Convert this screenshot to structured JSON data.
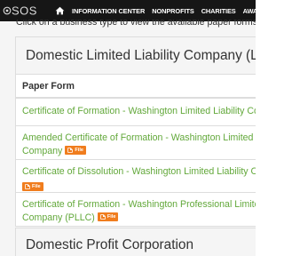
{
  "nav": {
    "logo_text": "SOS",
    "items": [
      {
        "label": "INFORMATION CENTER"
      },
      {
        "label": "NONPROFITS"
      },
      {
        "label": "CHARITIES"
      },
      {
        "label": "AWA"
      }
    ]
  },
  "intro_text": "Click on a business type to view the available paper forms a",
  "panels": [
    {
      "title": "Domestic Limited Liability Company (LL",
      "column_header": "Paper Form",
      "forms": [
        {
          "line1": "Certificate of Formation - Washington Limited Liability Co",
          "line2": "",
          "badge": ""
        },
        {
          "line1": "Amended Certificate of Formation - Washington Limited L",
          "line2": "Company",
          "badge": "File"
        },
        {
          "line1": "Certificate of Dissolution - Washington Limited Liability Co",
          "line2": "",
          "badge": "File"
        },
        {
          "line1": "Certificate of Formation - Washington Professional Limite",
          "line2": "Company (PLLC)",
          "badge": "File"
        }
      ]
    },
    {
      "title": "Domestic Profit Corporation"
    }
  ]
}
